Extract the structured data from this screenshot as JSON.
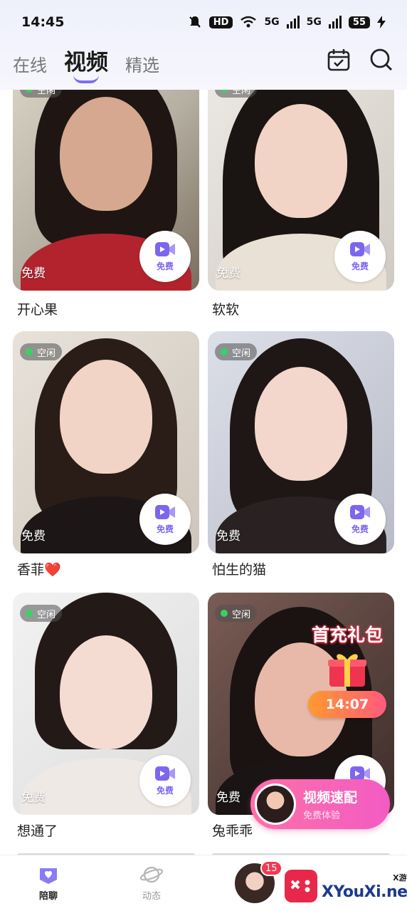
{
  "status_bar": {
    "time": "14:45",
    "hd_label": "HD",
    "network_1": "5G",
    "network_2": "5G",
    "battery": "55"
  },
  "header": {
    "tabs": [
      {
        "label": "在线",
        "active": false
      },
      {
        "label": "视频",
        "active": true
      },
      {
        "label": "精选",
        "active": false
      }
    ],
    "calendar_icon": "calendar-check-icon",
    "search_icon": "search-icon"
  },
  "cards": [
    {
      "name": "开心果",
      "status": "空闲",
      "free": "免费",
      "video_label": "免费"
    },
    {
      "name": "软软",
      "status": "空闲",
      "free": "免费",
      "video_label": "免费"
    },
    {
      "name": "香菲❤️",
      "status": "空闲",
      "free": "免费",
      "video_label": "免费"
    },
    {
      "name": "怕生的猫",
      "status": "空闲",
      "free": "免费",
      "video_label": "免费"
    },
    {
      "name": "想通了",
      "status": "空闲",
      "free": "免费",
      "video_label": "免费"
    },
    {
      "name": "兔乖乖",
      "status": "空闲",
      "free": "免费",
      "video_label": "免费"
    }
  ],
  "promo": {
    "title": "首充礼包",
    "timer": "14:07"
  },
  "match_button": {
    "title": "视频速配",
    "subtitle": "免费体验"
  },
  "bottom_nav": {
    "items": [
      {
        "label": "陪聊",
        "active": true
      },
      {
        "label": "动态",
        "active": false
      }
    ],
    "message_badge": "15"
  },
  "watermark": {
    "small": "X游戏",
    "big": "XYouXi.net"
  },
  "colors": {
    "accent": "#7c6ef2",
    "idle_dot": "#37d263",
    "match_gradient_start": "#ff6fa8",
    "badge": "#f2394f"
  }
}
